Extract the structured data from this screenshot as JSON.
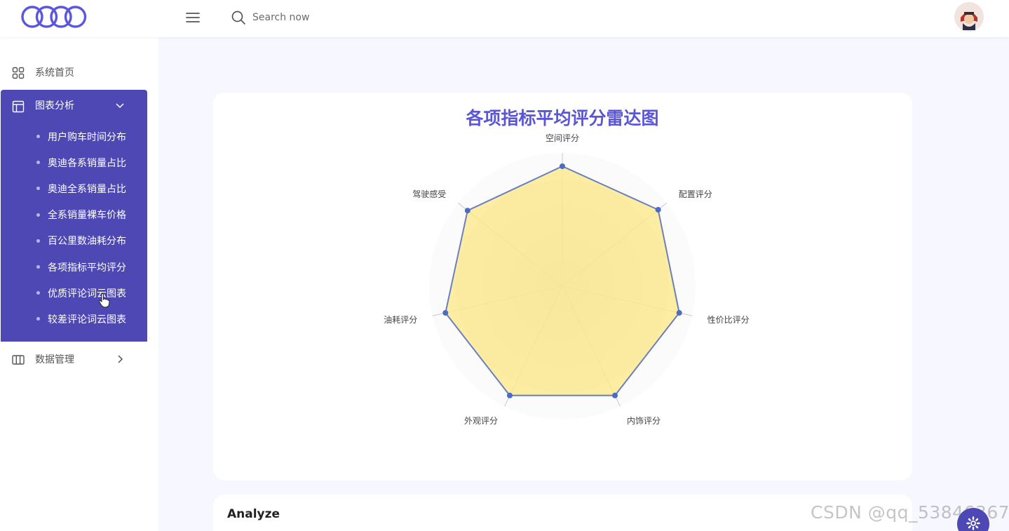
{
  "header": {
    "search_placeholder": "Search now"
  },
  "sidebar": {
    "home_label": "系统首页",
    "group_label": "图表分析",
    "sub_items": [
      "用户购车时间分布",
      "奥迪各系销量占比",
      "奥迪全系销量占比",
      "全系销量裸车价格",
      "百公里数油耗分布",
      "各项指标平均评分",
      "优质评论词云图表",
      "较差评论词云图表"
    ],
    "data_label": "数据管理"
  },
  "colors": {
    "accent": "#4e48b4",
    "title": "#5b56d6",
    "radar_fill": "#fde98f",
    "radar_line": "#6a7fbf",
    "radar_point": "#4a6bc6"
  },
  "chart_data": {
    "type": "radar",
    "title": "各项指标平均评分雷达图",
    "indicators": [
      "空间评分",
      "配置评分",
      "性价比评分",
      "内饰评分",
      "外观评分",
      "油耗评分",
      "驾驶感受"
    ],
    "values": [
      0.9,
      0.92,
      0.9,
      0.91,
      0.91,
      0.9,
      0.91
    ]
  },
  "analyze": {
    "title": "Analyze"
  },
  "watermark": "CSDN @qq_53846367"
}
